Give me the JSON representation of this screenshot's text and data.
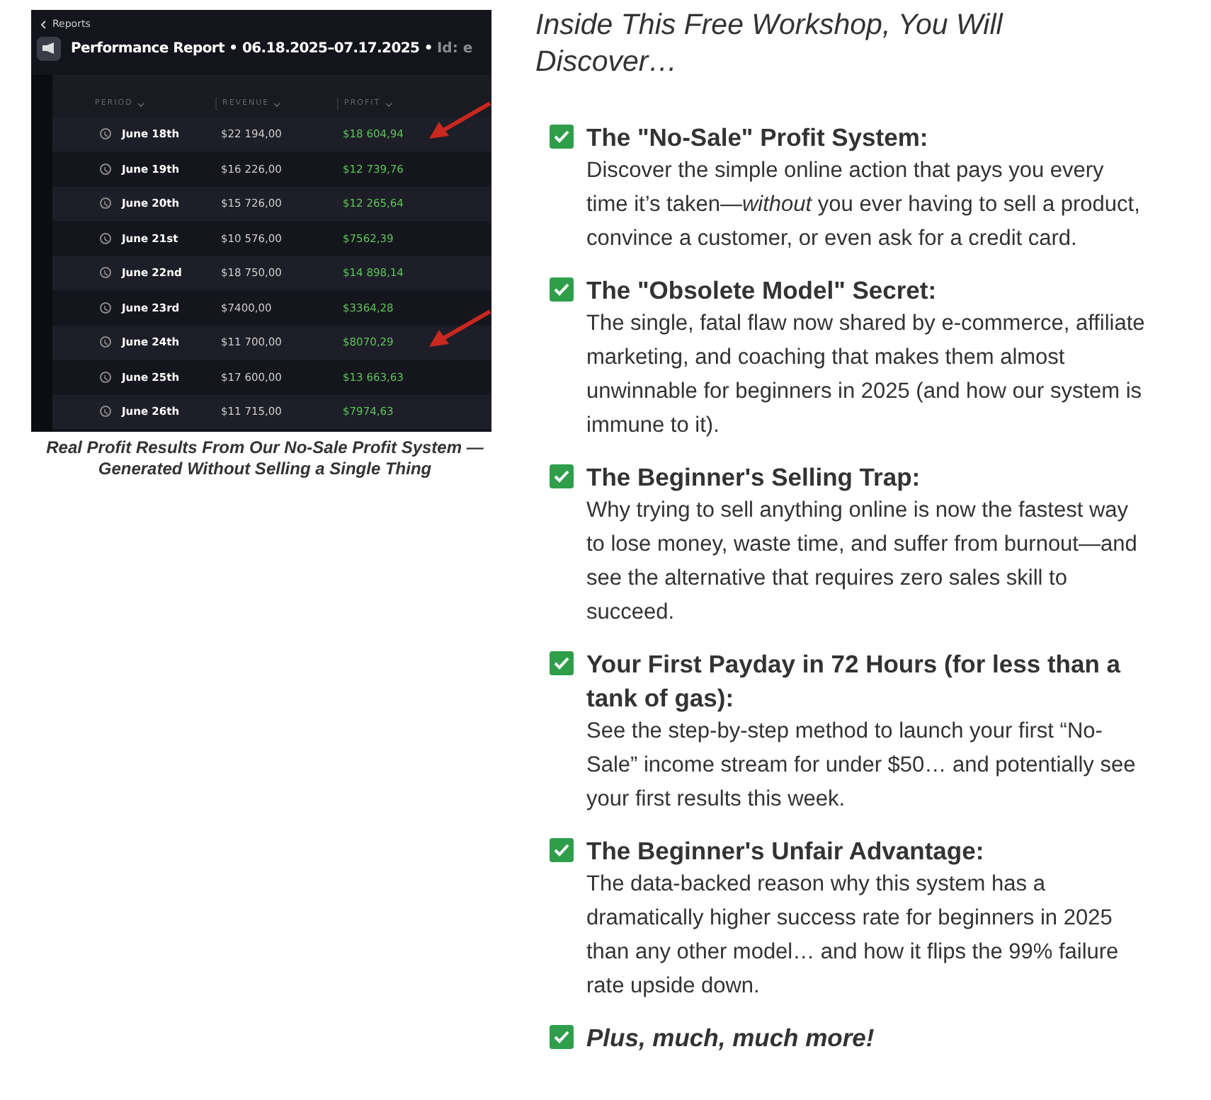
{
  "report_image": {
    "back_link": "Reports",
    "title": "Performance Report • 06.18.2025–07.17.2025 •",
    "title_cut": "Id: e",
    "columns": [
      "PERIOD",
      "REVENUE",
      "PROFIT"
    ],
    "rows": [
      {
        "period": "June 18th",
        "revenue": "$22 194,00",
        "profit": "$18 604,94",
        "annotated": true
      },
      {
        "period": "June 19th",
        "revenue": "$16 226,00",
        "profit": "$12 739,76",
        "annotated": false
      },
      {
        "period": "June 20th",
        "revenue": "$15 726,00",
        "profit": "$12 265,64",
        "annotated": false
      },
      {
        "period": "June 21st",
        "revenue": "$10 576,00",
        "profit": "$7562,39",
        "annotated": false
      },
      {
        "period": "June 22nd",
        "revenue": "$18 750,00",
        "profit": "$14 898,14",
        "annotated": false
      },
      {
        "period": "June 23rd",
        "revenue": "$7400,00",
        "profit": "$3364,28",
        "annotated": false
      },
      {
        "period": "June 24th",
        "revenue": "$11 700,00",
        "profit": "$8070,29",
        "annotated": true
      },
      {
        "period": "June 25th",
        "revenue": "$17 600,00",
        "profit": "$13 663,63",
        "annotated": false
      },
      {
        "period": "June 26th",
        "revenue": "$11 715,00",
        "profit": "$7974,63",
        "annotated": false
      }
    ],
    "caption": "Real Profit Results From Our No-Sale Profit System — Generated Without Selling a Single Thing"
  },
  "heading": "Inside This Free Workshop, You Will Discover…",
  "items": [
    {
      "kind": "point",
      "checked": true,
      "title": "The \"No-Sale\" Profit System:",
      "body": "Discover the simple online action that pays you every time it’s taken—*without* you ever having to sell a product, convince a customer, or even ask for a credit card."
    },
    {
      "kind": "point",
      "checked": true,
      "title": "The \"Obsolete Model\" Secret:",
      "body": "The single, fatal flaw now shared by e-commerce, affiliate marketing, and coaching that makes them almost unwinnable for beginners in 2025 (and how our system is immune to it)."
    },
    {
      "kind": "point",
      "checked": true,
      "title": "The Beginner's Selling Trap:",
      "body": "Why trying to sell anything online is now the fastest way to lose money, waste time, and suffer from burnout—and see the alternative that requires zero sales skill to succeed."
    },
    {
      "kind": "point",
      "checked": true,
      "title": "Your First Payday in 72 Hours (for less than a tank of gas):",
      "body": "See the step-by-step method to launch your first “No-Sale” income stream for under $50… and potentially see your first results this week."
    },
    {
      "kind": "point",
      "checked": true,
      "title": "The Beginner's Unfair Advantage:",
      "body": "The data-backed reason why this system has a dramatically higher success rate for beginners in 2025 than any other model… and how it flips the 99% failure rate upside down."
    },
    {
      "kind": "more",
      "checked": true,
      "title": "Plus, much, much more!"
    }
  ]
}
